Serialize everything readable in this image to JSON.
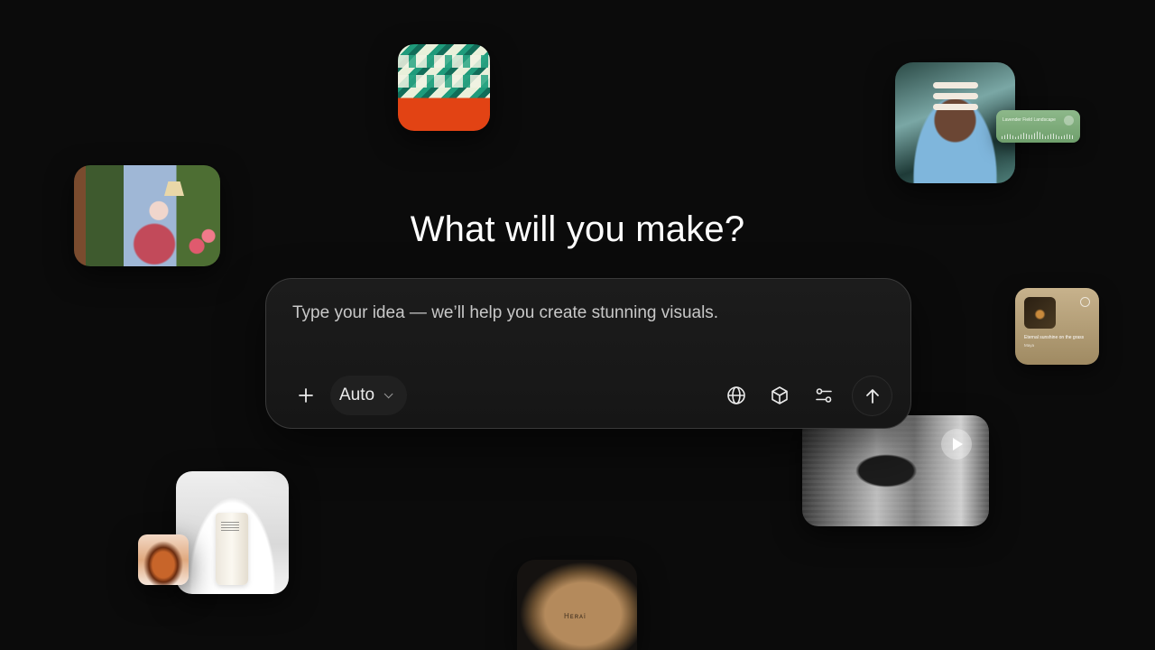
{
  "hero": {
    "title": "What will you make?"
  },
  "prompt": {
    "placeholder": "Type your idea — we’ll help you create stunning visuals.",
    "add_icon": "plus-icon",
    "model_label": "Auto",
    "model_icon": "chevron-down-icon",
    "tools": [
      {
        "icon": "globe-icon"
      },
      {
        "icon": "cube-icon"
      },
      {
        "icon": "sliders-icon"
      }
    ],
    "submit_icon": "arrow-up-icon"
  },
  "cards": {
    "audio": {
      "title": "Lavender Field Landscape"
    },
    "player": {
      "song": "Eternal sunshine on the grass",
      "artist": "Maya"
    },
    "product": {
      "brand": "Hᴇʀᴀi"
    }
  },
  "colors": {
    "background": "#0b0b0b",
    "prompt_box": "#181818",
    "text": "#ffffff"
  }
}
